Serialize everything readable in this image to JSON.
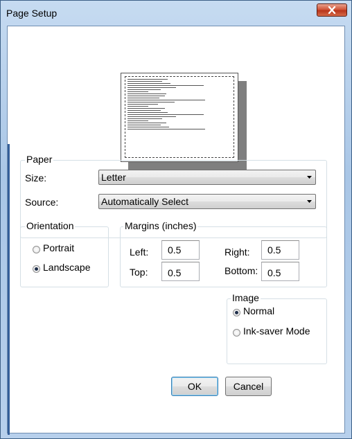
{
  "window": {
    "title": "Page Setup"
  },
  "paper": {
    "legend": "Paper",
    "size_label": "Size:",
    "size_value": "Letter",
    "source_label": "Source:",
    "source_value": "Automatically Select"
  },
  "orientation": {
    "legend": "Orientation",
    "options": [
      {
        "label": "Portrait",
        "checked": false
      },
      {
        "label": "Landscape",
        "checked": true
      }
    ]
  },
  "margins": {
    "legend": "Margins (inches)",
    "left_label": "Left:",
    "left_value": "0.5",
    "right_label": "Right:",
    "right_value": "0.5",
    "top_label": "Top:",
    "top_value": "0.5",
    "bottom_label": "Bottom:",
    "bottom_value": "0.5"
  },
  "image": {
    "legend": "Image",
    "options": [
      {
        "label": "Normal",
        "checked": true
      },
      {
        "label": "Ink-saver Mode",
        "checked": false
      }
    ]
  },
  "buttons": {
    "ok": "OK",
    "cancel": "Cancel"
  },
  "icons": {
    "close": "close-icon",
    "dropdown": "chevron-down-icon"
  }
}
